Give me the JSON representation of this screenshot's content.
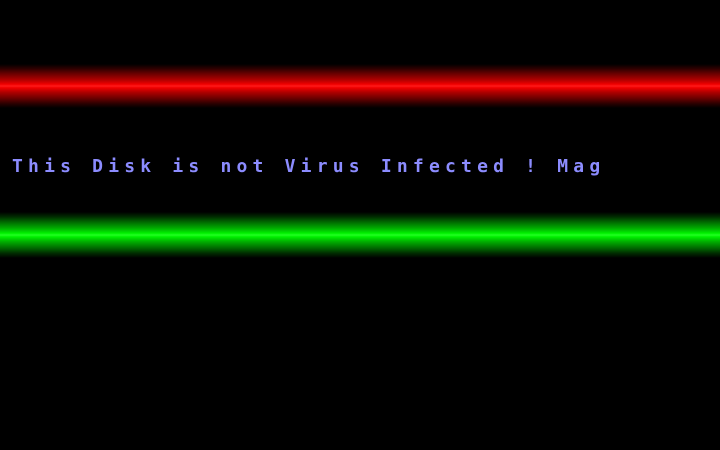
{
  "screen": {
    "scroll_text": "This Disk is not Virus Infected ! Mag",
    "colors": {
      "background": "#000000",
      "red_bar": "#ff0000",
      "green_bar": "#00ff00",
      "text": "#8c8cff"
    }
  }
}
